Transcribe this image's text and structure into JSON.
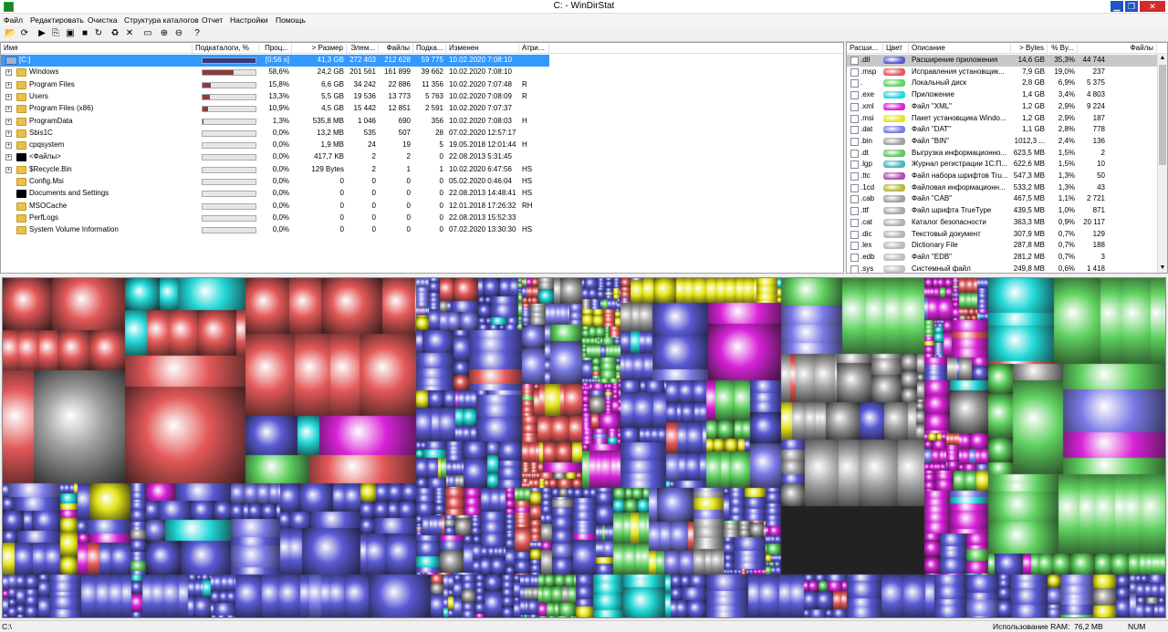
{
  "window": {
    "title": "C: - WinDirStat",
    "min": "▁",
    "max": "❐",
    "close": "✕"
  },
  "menu": [
    "Файл",
    "Редактировать",
    "Очистка",
    "Структура каталогов",
    "Отчет",
    "Настройки",
    "Помощь"
  ],
  "toolbar": [
    {
      "name": "open-icon",
      "glyph": "📂"
    },
    {
      "name": "rescan-icon",
      "glyph": "⟳"
    },
    {
      "name": "play-icon",
      "glyph": "▶"
    },
    {
      "name": "copy-icon",
      "glyph": "⎘"
    },
    {
      "name": "explorer-icon",
      "glyph": "▣"
    },
    {
      "name": "cmd-icon",
      "glyph": "■"
    },
    {
      "name": "refresh-icon",
      "glyph": "↻"
    },
    {
      "name": "recycle-icon",
      "glyph": "♻"
    },
    {
      "name": "delete-icon",
      "glyph": "✕"
    },
    {
      "name": "new-folder-icon",
      "glyph": "▭"
    },
    {
      "name": "zoom-in-icon",
      "glyph": "⊕"
    },
    {
      "name": "zoom-out-icon",
      "glyph": "⊖"
    },
    {
      "name": "help-icon",
      "glyph": "?"
    }
  ],
  "tree": {
    "columns": [
      "Имя",
      "Подкаталоги, %",
      "Проц...",
      "> Размер",
      "Элем...",
      "Файлы",
      "Подка...",
      "Изменен",
      "Атри..."
    ],
    "rows": [
      {
        "name": "[C:]",
        "type": "drive",
        "pct": "[0:56 s]",
        "bar": 1.0,
        "size": "41,3 GB",
        "items": "272 403",
        "files": "212 628",
        "subdirs": "59 775",
        "modified": "10.02.2020 7:08:10",
        "attr": "",
        "selected": true
      },
      {
        "name": "Windows",
        "type": "folder",
        "pct": "58,6%",
        "bar": 0.586,
        "size": "24,2 GB",
        "items": "201 561",
        "files": "161 899",
        "subdirs": "39 662",
        "modified": "10.02.2020 7:08:10",
        "attr": ""
      },
      {
        "name": "Program Files",
        "type": "folder",
        "pct": "15,8%",
        "bar": 0.158,
        "size": "6,6 GB",
        "items": "34 242",
        "files": "22 886",
        "subdirs": "11 356",
        "modified": "10.02.2020 7:07:48",
        "attr": "R"
      },
      {
        "name": "Users",
        "type": "folder",
        "pct": "13,3%",
        "bar": 0.133,
        "size": "5,5 GB",
        "items": "19 536",
        "files": "13 773",
        "subdirs": "5 763",
        "modified": "10.02.2020 7:08:09",
        "attr": "R"
      },
      {
        "name": "Program Files (x86)",
        "type": "folder",
        "pct": "10,9%",
        "bar": 0.109,
        "size": "4,5 GB",
        "items": "15 442",
        "files": "12 851",
        "subdirs": "2 591",
        "modified": "10.02.2020 7:07:37",
        "attr": ""
      },
      {
        "name": "ProgramData",
        "type": "folder",
        "pct": "1,3%",
        "bar": 0.013,
        "size": "535,8 MB",
        "items": "1 046",
        "files": "690",
        "subdirs": "356",
        "modified": "10.02.2020 7:08:03",
        "attr": "H"
      },
      {
        "name": "Sbis1C",
        "type": "folder",
        "pct": "0,0%",
        "bar": 0,
        "size": "13,2 MB",
        "items": "535",
        "files": "507",
        "subdirs": "28",
        "modified": "07.02.2020 12:57:17",
        "attr": ""
      },
      {
        "name": "cpqsystem",
        "type": "folder",
        "pct": "0,0%",
        "bar": 0,
        "size": "1,9 MB",
        "items": "24",
        "files": "19",
        "subdirs": "5",
        "modified": "19.05.2018 12:01:44",
        "attr": "H"
      },
      {
        "name": "<Файлы>",
        "type": "black",
        "pct": "0,0%",
        "bar": 0,
        "size": "417,7 KB",
        "items": "2",
        "files": "2",
        "subdirs": "0",
        "modified": "22.08.2013 5:31:45",
        "attr": ""
      },
      {
        "name": "$Recycle.Bin",
        "type": "folder",
        "pct": "0,0%",
        "bar": 0,
        "size": "129 Bytes",
        "items": "2",
        "files": "1",
        "subdirs": "1",
        "modified": "10.02.2020 6:47:56",
        "attr": "HS"
      },
      {
        "name": "Config.Msi",
        "type": "folder",
        "pct": "0,0%",
        "bar": 0,
        "size": "0",
        "items": "0",
        "files": "0",
        "subdirs": "0",
        "modified": "05.02.2020 0:46:04",
        "attr": "HS"
      },
      {
        "name": "Documents and Settings",
        "type": "black",
        "pct": "0,0%",
        "bar": 0,
        "size": "0",
        "items": "0",
        "files": "0",
        "subdirs": "0",
        "modified": "22.08.2013 14:48:41",
        "attr": "HS"
      },
      {
        "name": "MSOCache",
        "type": "folder",
        "pct": "0,0%",
        "bar": 0,
        "size": "0",
        "items": "0",
        "files": "0",
        "subdirs": "0",
        "modified": "12.01.2018 17:26:32",
        "attr": "RH"
      },
      {
        "name": "PerfLogs",
        "type": "folder",
        "pct": "0,0%",
        "bar": 0,
        "size": "0",
        "items": "0",
        "files": "0",
        "subdirs": "0",
        "modified": "22.08.2013 15:52:33",
        "attr": ""
      },
      {
        "name": "System Volume Information",
        "type": "folder",
        "pct": "0,0%",
        "bar": 0,
        "size": "0",
        "items": "0",
        "files": "0",
        "subdirs": "0",
        "modified": "07.02.2020 13:30:30",
        "attr": "HS"
      }
    ]
  },
  "extensions": {
    "columns": [
      "Расши...",
      "Цвет",
      "Описание",
      "> Bytes",
      "% By...",
      "Файлы"
    ],
    "rows": [
      {
        "ext": ".dll",
        "color": "#5a5ad6",
        "desc": "Расширение приложения",
        "bytes": "14,6 GB",
        "pct": "35,3%",
        "files": "44 744",
        "selected": true
      },
      {
        "ext": ".msp",
        "color": "#e45858",
        "desc": "Исправления установщик...",
        "bytes": "7,9 GB",
        "pct": "19,0%",
        "files": "237"
      },
      {
        "ext": ".",
        "color": "#5fd15f",
        "desc": "Локальный диск",
        "bytes": "2,8 GB",
        "pct": "6,9%",
        "files": "5 375"
      },
      {
        "ext": ".exe",
        "color": "#22d8d8",
        "desc": "Приложение",
        "bytes": "1,4 GB",
        "pct": "3,4%",
        "files": "4 803"
      },
      {
        "ext": ".xml",
        "color": "#d822d8",
        "desc": "Файл \"XML\"",
        "bytes": "1,2 GB",
        "pct": "2,9%",
        "files": "9 224"
      },
      {
        "ext": ".msi",
        "color": "#e6e61a",
        "desc": "Пакет установщика Windo...",
        "bytes": "1,2 GB",
        "pct": "2,9%",
        "files": "187"
      },
      {
        "ext": ".dat",
        "color": "#7a7ae8",
        "desc": "Файл \"DAT\"",
        "bytes": "1,1 GB",
        "pct": "2,8%",
        "files": "778"
      },
      {
        "ext": ".bin",
        "color": "#a0a0a0",
        "desc": "Файл \"BIN\"",
        "bytes": "1012,3 ...",
        "pct": "2,4%",
        "files": "136"
      },
      {
        "ext": ".dt",
        "color": "#62c462",
        "desc": "Выгрузка информационно...",
        "bytes": "623,5 MB",
        "pct": "1,5%",
        "files": "2"
      },
      {
        "ext": ".lgp",
        "color": "#4ab7b7",
        "desc": "Журнал регистрации 1С:П...",
        "bytes": "622,6 MB",
        "pct": "1,5%",
        "files": "10"
      },
      {
        "ext": ".ttc",
        "color": "#b04cb0",
        "desc": "Файл набора шрифтов Tru...",
        "bytes": "547,3 MB",
        "pct": "1,3%",
        "files": "50"
      },
      {
        "ext": ".1cd",
        "color": "#b8b83a",
        "desc": "Файловая информационн...",
        "bytes": "533,2 MB",
        "pct": "1,3%",
        "files": "43"
      },
      {
        "ext": ".cab",
        "color": "#9e9e9e",
        "desc": "Файл \"CAB\"",
        "bytes": "467,5 MB",
        "pct": "1,1%",
        "files": "2 721"
      },
      {
        "ext": ".ttf",
        "color": "#a8a8a8",
        "desc": "Файл шрифта TrueType",
        "bytes": "439,5 MB",
        "pct": "1,0%",
        "files": "871"
      },
      {
        "ext": ".cat",
        "color": "#b0b0b0",
        "desc": "Каталог безопасности",
        "bytes": "363,3 MB",
        "pct": "0,9%",
        "files": "20 117"
      },
      {
        "ext": ".dic",
        "color": "#b4b4b4",
        "desc": "Текстовый документ",
        "bytes": "307,9 MB",
        "pct": "0,7%",
        "files": "129"
      },
      {
        "ext": ".lex",
        "color": "#b8b8b8",
        "desc": "Dictionary File",
        "bytes": "287,8 MB",
        "pct": "0,7%",
        "files": "188"
      },
      {
        "ext": ".edb",
        "color": "#bcbcbc",
        "desc": "Файл \"EDB\"",
        "bytes": "281,2 MB",
        "pct": "0,7%",
        "files": "3"
      },
      {
        "ext": ".sys",
        "color": "#c0c0c0",
        "desc": "Системный файл",
        "bytes": "249,8 MB",
        "pct": "0,6%",
        "files": "1 418"
      }
    ]
  },
  "status": {
    "path": "C:\\",
    "ram_label": "Использование RAM:",
    "ram_value": "76,2 MB",
    "num": "NUM"
  }
}
